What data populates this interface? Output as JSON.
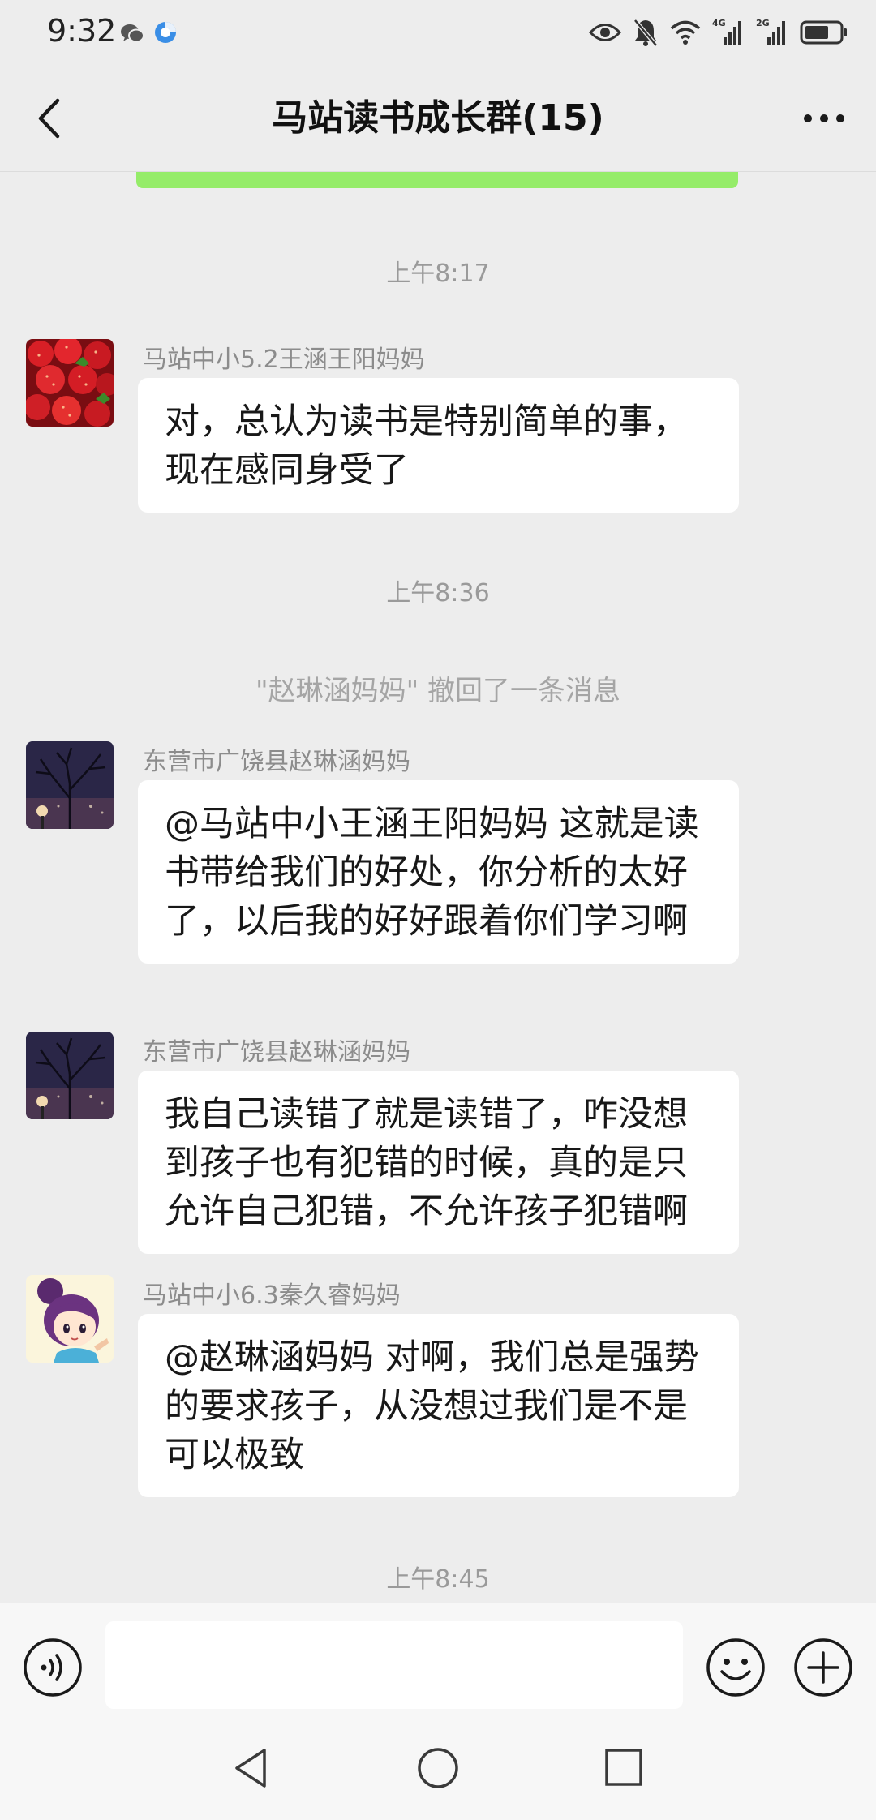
{
  "status_bar": {
    "time": "9:32",
    "net_label_1": "4G",
    "net_label_2": "2G",
    "app_icons": [
      "wechat-icon",
      "browser-icon"
    ],
    "system_icons": [
      "eye-icon",
      "mute-bell-icon",
      "wifi-icon",
      "signal-4g-icon",
      "signal-2g-icon",
      "battery-icon"
    ]
  },
  "header": {
    "title": "马站读书成长群(15)",
    "back_icon": "chevron-left-icon",
    "more_icon": "more-dots-icon"
  },
  "chat": {
    "items": [
      {
        "type": "timestamp",
        "text": "上午8:17"
      },
      {
        "type": "message",
        "sender": "马站中小5.2王涵王阳妈妈",
        "avatar": "strawberry-avatar",
        "text": "对，总认为读书是特别简单的事，现在感同身受了"
      },
      {
        "type": "timestamp",
        "text": "上午8:36"
      },
      {
        "type": "system",
        "text": "\"赵琳涵妈妈\" 撤回了一条消息"
      },
      {
        "type": "message",
        "sender": "东营市广饶县赵琳涵妈妈",
        "avatar": "night-tree-avatar",
        "text": "@马站中小王涵王阳妈妈  这就是读书带给我们的好处，你分析的太好了，以后我的好好跟着你们学习啊"
      },
      {
        "type": "message",
        "sender": "东营市广饶县赵琳涵妈妈",
        "avatar": "night-tree-avatar",
        "text": "我自己读错了就是读错了，咋没想到孩子也有犯错的时候，真的是只允许自己犯错，不允许孩子犯错啊"
      },
      {
        "type": "message",
        "sender": "马站中小6.3秦久睿妈妈",
        "avatar": "cartoon-girl-avatar",
        "text": "@赵琳涵妈妈  对啊，我们总是强势的要求孩子，从没想过我们是不是可以极致"
      },
      {
        "type": "timestamp",
        "text": "上午8:45"
      }
    ]
  },
  "input_bar": {
    "value": "",
    "voice_icon": "voice-input-icon",
    "emoji_icon": "emoji-icon",
    "plus_icon": "plus-circle-icon"
  },
  "nav_bar": {
    "icons": [
      "nav-back-icon",
      "nav-home-icon",
      "nav-recent-icon"
    ]
  },
  "colors": {
    "background": "#ededed",
    "bubble": "#ffffff",
    "accent_green": "#95ec69",
    "sender_text": "#8c8c8c",
    "timestamp_text": "#9a9a9a"
  }
}
